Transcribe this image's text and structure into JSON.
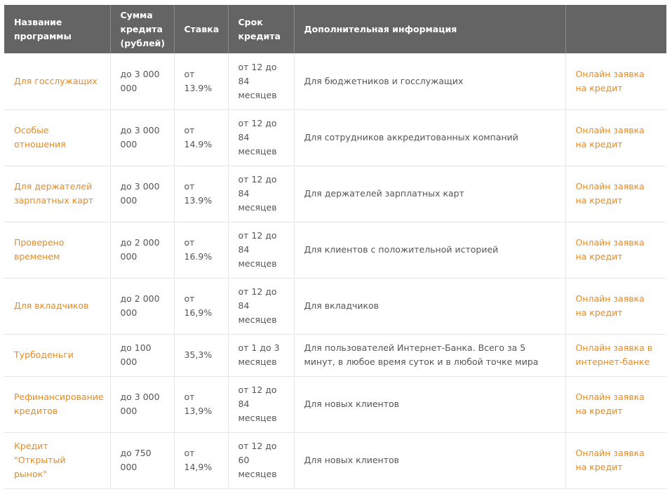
{
  "table": {
    "headers": [
      "Название программы",
      "Сумма кредита (рублей)",
      "Ставка",
      "Срок кредита",
      "Дополнительная информация",
      ""
    ],
    "rows": [
      {
        "name": "Для госслужащих",
        "amount": "до 3 000 000",
        "rate": "от 13.9%",
        "term": "от 12 до 84 месяцев",
        "info": "Для бюджетников и госслужащих",
        "action": "Онлайн заявка на кредит"
      },
      {
        "name": "Особые отношения",
        "amount": "до 3 000 000",
        "rate": "от 14.9%",
        "term": "от 12 до 84 месяцев",
        "info": "Для сотрудников аккредитованных компаний",
        "action": "Онлайн заявка на кредит"
      },
      {
        "name": "Для держателей зарплатных карт",
        "amount": "до 3 000 000",
        "rate": "от 13.9%",
        "term": "от 12 до 84 месяцев",
        "info": "Для держателей зарплатных карт",
        "action": "Онлайн заявка на кредит"
      },
      {
        "name": "Проверено временем",
        "amount": "до 2 000 000",
        "rate": "от 16.9%",
        "term": "от 12 до 84 месяцев",
        "info": "Для клиентов с положительной историей",
        "action": "Онлайн заявка на кредит"
      },
      {
        "name": "Для вкладчиков",
        "amount": "до 2 000 000",
        "rate": "от 16,9%",
        "term": "от 12 до 84 месяцев",
        "info": "Для вкладчиков",
        "action": "Онлайн заявка на кредит"
      },
      {
        "name": "Турбоденьги",
        "amount": "до 100 000",
        "rate": "35,3%",
        "term": "от 1 до 3 месяцев",
        "info": "Для пользователей Интернет-Банка. Всего за 5 минут, в любое время суток и в любой точке мира",
        "action": "Онлайн заявка в интернет-банке"
      },
      {
        "name": "Рефинансирование кредитов",
        "amount": "до 3 000 000",
        "rate": "от 13,9%",
        "term": "от 12 до 84 месяцев",
        "info": "Для новых клиентов",
        "action": "Онлайн заявка на кредит"
      },
      {
        "name": "Кредит \"Открытый рынок\"",
        "amount": "до 750 000",
        "rate": "от 14,9%",
        "term": "от 12 до 60 месяцев",
        "info": "Для новых клиентов",
        "action": "Онлайн заявка на кредит"
      }
    ]
  },
  "colors": {
    "header_bg": "#646464",
    "link": "#e98a1f",
    "text": "#555555",
    "border": "#e6e6e6"
  }
}
